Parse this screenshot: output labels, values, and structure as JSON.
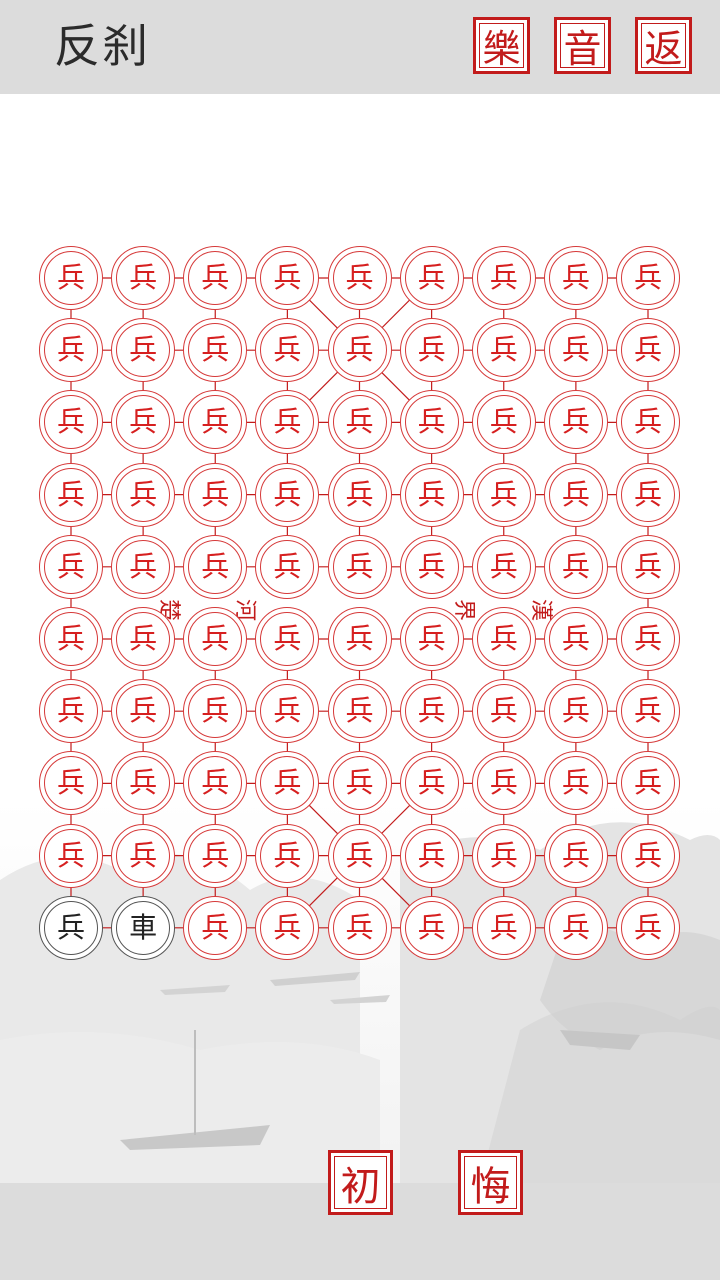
{
  "header": {
    "title": "反刹",
    "music_label": "樂",
    "sound_label": "音",
    "back_label": "返"
  },
  "footer": {
    "restart_label": "初",
    "undo_label": "悔"
  },
  "board": {
    "columns": 9,
    "rows": 10,
    "red_piece_char": "兵",
    "black_pieces": [
      "兵",
      "車"
    ],
    "river_text": [
      "楚",
      "河",
      "界",
      "漢"
    ]
  },
  "colors": {
    "accent_red": "#c21b1b",
    "bar_gray": "#dcdcdc"
  }
}
